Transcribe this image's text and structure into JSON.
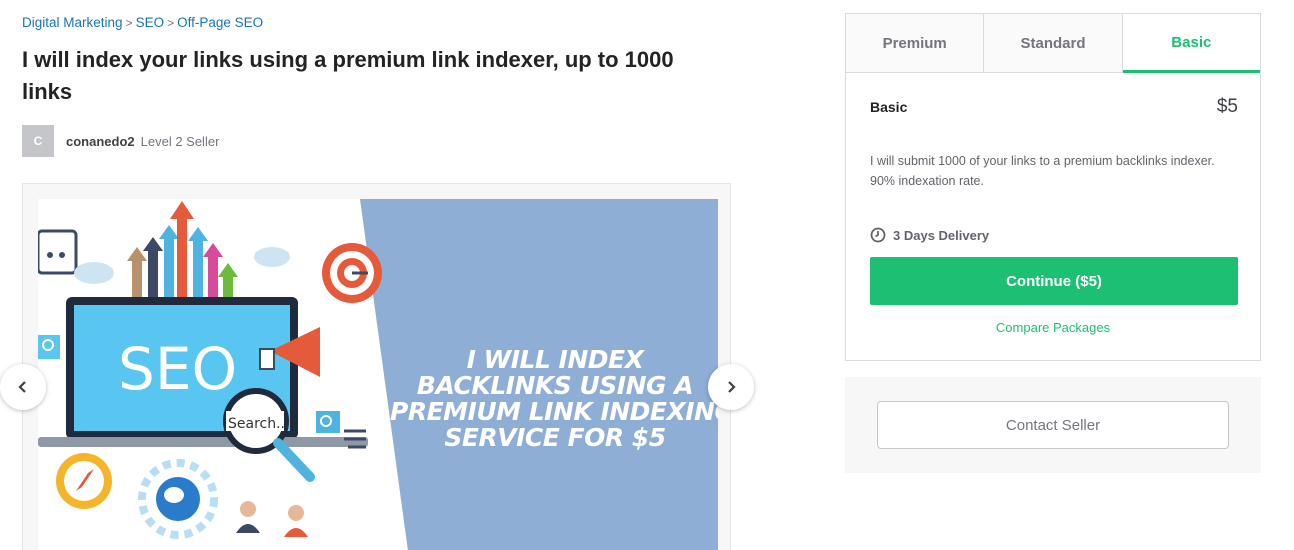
{
  "breadcrumb": {
    "items": [
      "Digital Marketing",
      "SEO",
      "Off-Page SEO"
    ],
    "separator": ">"
  },
  "gig": {
    "title": "I will index your links using a premium link indexer, up to 1000 links"
  },
  "seller": {
    "avatar_initial": "C",
    "name": "conanedo2",
    "level": "Level 2 Seller"
  },
  "gallery": {
    "image_lines": [
      "I WILL INDEX",
      "BACKLINKS USING A",
      "PREMIUM LINK INDEXING",
      "SERVICE FOR $5"
    ],
    "screen_text": "SEO",
    "search_text": "Search..."
  },
  "packages": {
    "tabs": [
      {
        "label": "Premium",
        "active": false
      },
      {
        "label": "Standard",
        "active": false
      },
      {
        "label": "Basic",
        "active": true
      }
    ],
    "selected": {
      "name": "Basic",
      "price": "$5",
      "description": "I will submit 1000 of your links to a premium backlinks indexer. 90% indexation rate.",
      "delivery": "3 Days Delivery"
    },
    "continue_label": "Continue ($5)",
    "compare_label": "Compare Packages"
  },
  "contact": {
    "button_label": "Contact Seller"
  },
  "colors": {
    "accent": "#1dbf73",
    "link": "#1a73b8",
    "slide_bg": "#8faed6"
  },
  "icons": {
    "prev": "chevron-left-icon",
    "next": "chevron-right-icon",
    "delivery": "clock-icon"
  }
}
